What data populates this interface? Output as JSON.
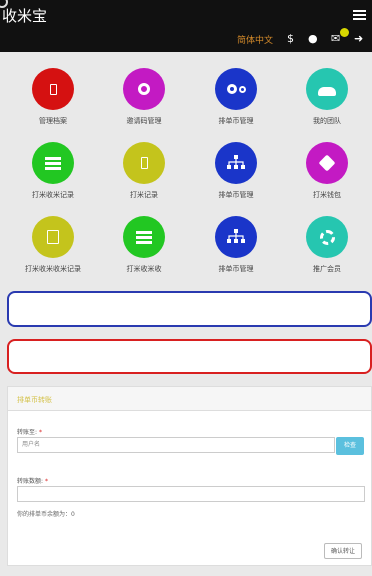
{
  "header": {
    "brand": "收米宝",
    "lang": "简体中文",
    "icons": [
      "menu-icon",
      "dollar-icon",
      "user-icon",
      "mail-icon",
      "share-icon"
    ]
  },
  "tiles": [
    {
      "label": "管理档案",
      "color": "#d51111",
      "icon": "document-icon"
    },
    {
      "label": "邀请码管理",
      "color": "#c31ac3",
      "icon": "gear-icon"
    },
    {
      "label": "排单币管理",
      "color": "#1a35c9",
      "icon": "gears-icon"
    },
    {
      "label": "我的团队",
      "color": "#26c6b0",
      "icon": "team-icon"
    },
    {
      "label": "打米收米记录",
      "color": "#22c722",
      "icon": "list-icon"
    },
    {
      "label": "打米记录",
      "color": "#c4c41c",
      "icon": "document-icon"
    },
    {
      "label": "排单币管理",
      "color": "#1a35c9",
      "icon": "sitemap-icon"
    },
    {
      "label": "打米钱包",
      "color": "#c31ac3",
      "icon": "tag-icon"
    },
    {
      "label": "打米收米收米记录",
      "color": "#c4c41c",
      "icon": "doc-icon"
    },
    {
      "label": "打米收米收",
      "color": "#22c722",
      "icon": "list-icon"
    },
    {
      "label": "排单币管理",
      "color": "#1a35c9",
      "icon": "sitemap-icon"
    },
    {
      "label": "推广会员",
      "color": "#26c6b0",
      "icon": "gear-icon"
    }
  ],
  "form": {
    "title": "排单币转账",
    "to_label": "转账至:",
    "to_placeholder": "用户名",
    "check_label": "检查",
    "amount_label": "转账数额:",
    "amount_placeholder": "",
    "hint": "你的排单币余额为：0",
    "confirm_label": "确认转让"
  }
}
